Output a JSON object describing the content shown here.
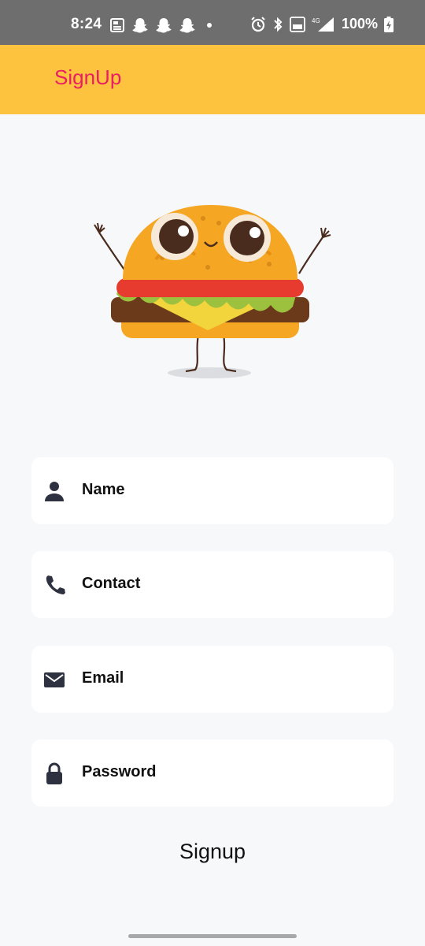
{
  "status_bar": {
    "time": "8:24",
    "battery": "100%",
    "left_icons": [
      "news-icon",
      "snapchat-icon",
      "snapchat-icon",
      "snapchat-icon",
      "dot-icon"
    ],
    "right_icons": [
      "alarm-icon",
      "bluetooth-icon",
      "volte-icon",
      "signal-4g-icon",
      "battery-charging-icon"
    ]
  },
  "app_bar": {
    "title": "SignUp",
    "background": "#fdc23e",
    "title_color": "#e91e63"
  },
  "illustration": {
    "icon": "burger-mascot-illustration"
  },
  "form": {
    "fields": [
      {
        "label": "Name",
        "icon": "person-icon"
      },
      {
        "label": "Contact",
        "icon": "phone-icon"
      },
      {
        "label": "Email",
        "icon": "mail-icon"
      },
      {
        "label": "Password",
        "icon": "lock-icon"
      }
    ],
    "submit_label": "Signup"
  }
}
